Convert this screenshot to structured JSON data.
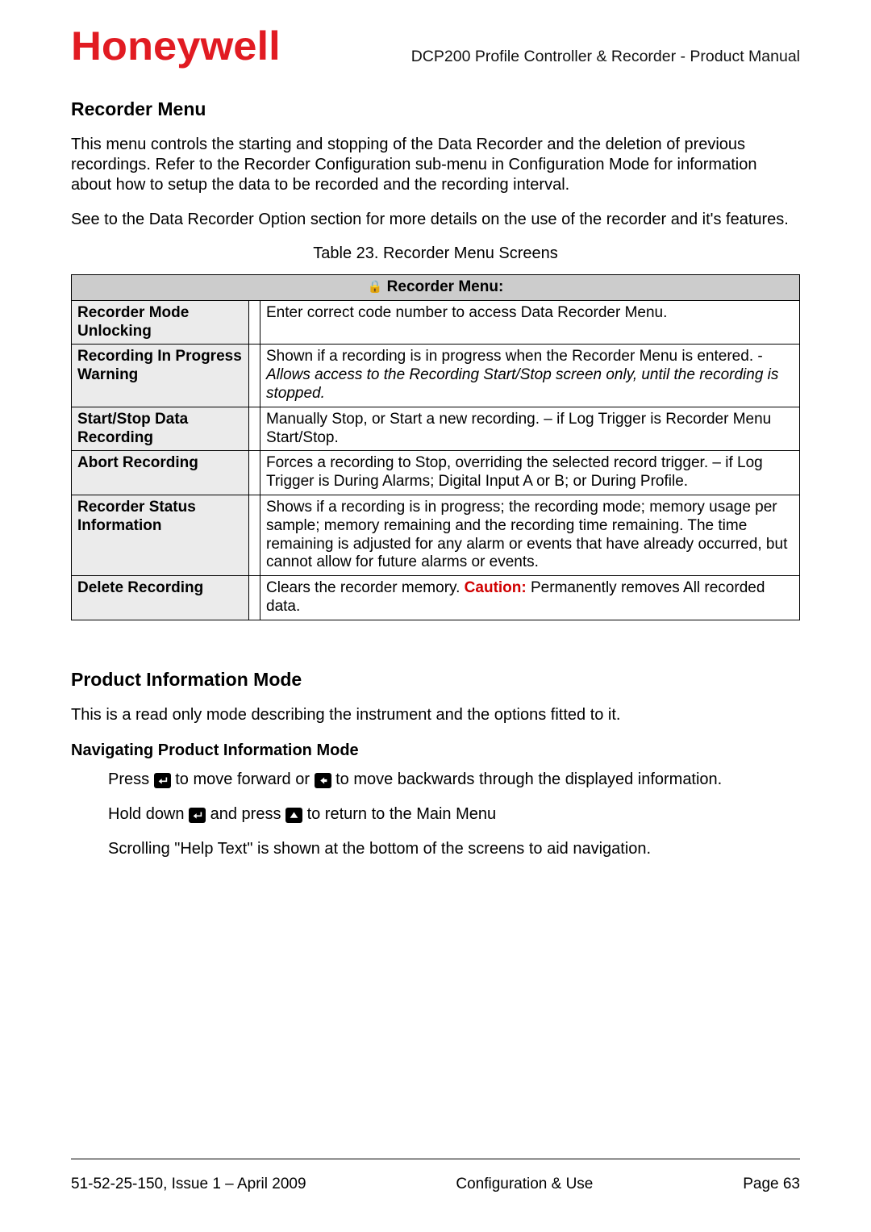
{
  "header": {
    "logo": "Honeywell",
    "doc_title": "DCP200 Profile Controller & Recorder - Product Manual"
  },
  "section1": {
    "heading": "Recorder Menu",
    "para1": "This menu controls the starting and stopping of the Data Recorder and the deletion of previous recordings. Refer to the Recorder Configuration sub-menu in Configuration Mode for information about how to setup the data to be recorded and the recording interval.",
    "para2": "See to the Data Recorder Option section for more details on the use of the recorder and it's features.",
    "table_title": "Table 23. Recorder Menu Screens"
  },
  "table": {
    "header": "Recorder Menu:",
    "rows": [
      {
        "left": "Recorder Mode Unlocking",
        "right_plain": "Enter correct code number to access Data Recorder Menu."
      },
      {
        "left": "Recording In Progress Warning",
        "right_pre": "Shown if a recording is in progress when the Recorder Menu is entered. - ",
        "right_em": "Allows access to the Recording Start/Stop screen only, until the recording is stopped."
      },
      {
        "left": "Start/Stop Data Recording",
        "right_plain": "Manually Stop, or Start a new recording. – if Log Trigger is Recorder Menu Start/Stop."
      },
      {
        "left": "Abort Recording",
        "right_plain": "Forces a recording to Stop, overriding the selected record trigger. – if Log Trigger is During Alarms; Digital Input A or B; or During Profile."
      },
      {
        "left": "Recorder Status Information",
        "right_plain": "Shows if a recording is in progress; the recording mode; memory usage per sample; memory remaining and the recording time remaining. The time remaining is adjusted for any alarm or events that have already occurred, but cannot allow for future alarms or events."
      },
      {
        "left": "Delete Recording",
        "right_pre": "Clears the recorder memory. ",
        "caution_label": "Caution:",
        "right_post": " Permanently removes All recorded data."
      }
    ]
  },
  "section2": {
    "heading": "Product Information Mode",
    "para1": "This is a read only mode describing the instrument and the options fitted to it.",
    "subhead": "Navigating Product Information Mode",
    "nav_line1_a": "Press ",
    "nav_line1_b": "  to move forward or ",
    "nav_line1_c": "  to move backwards through the displayed information.",
    "nav_line2_a": "Hold down ",
    "nav_line2_b": " and press ",
    "nav_line2_c": " to return to the Main Menu",
    "nav_line3": "Scrolling \"Help Text\" is shown at the bottom of the screens to aid navigation."
  },
  "footer": {
    "left": "51-52-25-150, Issue 1 – April 2009",
    "center": "Configuration & Use",
    "right": "Page 63"
  }
}
